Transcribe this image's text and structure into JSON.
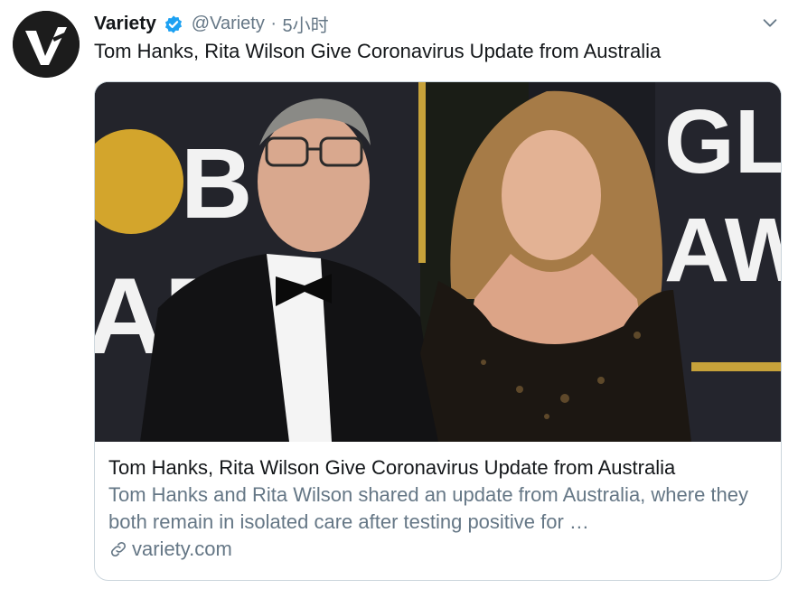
{
  "tweet": {
    "author": {
      "display_name": "Variety",
      "handle": "@Variety",
      "avatar_icon": "variety-logo-icon",
      "verified": true
    },
    "separator": "·",
    "timestamp": "5小时",
    "text": "Tom Hanks, Rita Wilson Give Coronavirus Update from Australia",
    "card": {
      "image_description_icon": "photo",
      "title": "Tom Hanks, Rita Wilson Give Coronavirus Update from Australia",
      "description": "Tom Hanks and Rita Wilson shared an update from Australia, where they both remain in isolated care after testing positive for …",
      "domain": "variety.com"
    }
  },
  "colors": {
    "text_primary": "#14171a",
    "text_secondary": "#657786",
    "verified_blue": "#1da1f2",
    "card_border": "#ccd6dd"
  }
}
